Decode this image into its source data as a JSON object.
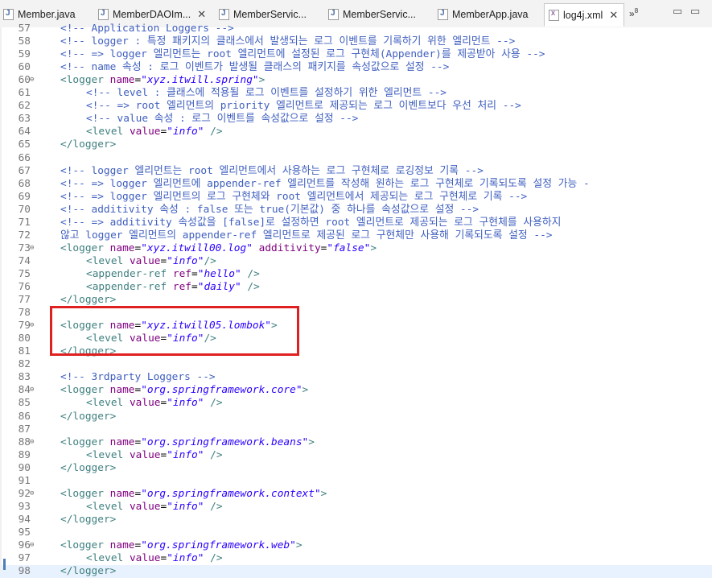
{
  "tabs": [
    {
      "label": "Member.java",
      "icon": "java-file-icon",
      "active": false
    },
    {
      "label": "MemberDAOIm...",
      "icon": "java-file-icon",
      "active": false
    },
    {
      "label": "MemberServic...",
      "icon": "java-file-icon",
      "active": false
    },
    {
      "label": "MemberServic...",
      "icon": "java-file-icon",
      "active": false
    },
    {
      "label": "MemberApp.java",
      "icon": "java-file-icon",
      "active": false
    },
    {
      "label": "log4j.xml",
      "icon": "xml-file-icon",
      "active": true
    }
  ],
  "overflow_count": "8",
  "highlight_color": "#e02020",
  "lines": [
    {
      "n": "57",
      "text": "<!-- Application Loggers -->"
    },
    {
      "n": "58",
      "text": "<!-- logger : 특정 패키지의 클래스에서 발생되는 로그 이벤트를 기록하기 위한 엘리먼트 -->"
    },
    {
      "n": "59",
      "text": "<!-- => logger 엘리먼트는 root 엘리먼트에 설정된 로그 구현체(Appender)를 제공받아 사용 -->"
    },
    {
      "n": "60",
      "text": "<!-- name 속성 : 로그 이벤트가 발생될 클래스의 패키지를 속성값으로 설정 -->"
    },
    {
      "n": "60",
      "text": "<logger name=\"xyz.itwill.spring\">"
    },
    {
      "n": "61",
      "text": "<!-- level : 클래스에 적용될 로그 이벤트를 설정하기 위한 엘리먼트 -->"
    },
    {
      "n": "62",
      "text": "<!-- => root 엘리먼트의 priority 엘리먼트로 제공되는 로그 이벤트보다 우선 처리 -->"
    },
    {
      "n": "63",
      "text": "<!-- value 속성 : 로그 이벤트를 속성값으로 설정 -->"
    },
    {
      "n": "64",
      "text": "<level value=\"info\" />"
    },
    {
      "n": "65",
      "text": "</logger>"
    },
    {
      "n": "66",
      "text": ""
    },
    {
      "n": "67",
      "text": "<!-- logger 엘리먼트는 root 엘리먼트에서 사용하는 로그 구현체로 로깅정보 기록 -->"
    },
    {
      "n": "68",
      "text": "<!-- => logger 엘리먼트에 appender-ref 엘리먼트를 작성해 원하는 로그 구현체로 기록되도록 설정 가능 -"
    },
    {
      "n": "69",
      "text": "<!-- => logger 엘리먼트의 로그 구현체와 root 엘리먼트에서 제공되는 로그 구현체로 기록 -->"
    },
    {
      "n": "70",
      "text": "<!-- additivity 속성 : false 또는 true(기본값) 중 하나를 속성값으로 설정 -->"
    },
    {
      "n": "71",
      "text": "<!-- => additivity 속성값을 [false]로 설정하면 root 엘리먼트로 제공되는 로그 구현체를 사용하지"
    },
    {
      "n": "72",
      "text": "않고 logger 엘리먼트의 appender-ref 엘리먼트로 제공된 로그 구현체만 사용해 기록되도록 설정 -->"
    },
    {
      "n": "73",
      "text": "<logger name=\"xyz.itwill00.log\" additivity=\"false\">"
    },
    {
      "n": "74",
      "text": "<level value=\"info\"/>"
    },
    {
      "n": "75",
      "text": "<appender-ref ref=\"hello\" />"
    },
    {
      "n": "76",
      "text": "<appender-ref ref=\"daily\" />"
    },
    {
      "n": "77",
      "text": "</logger>"
    },
    {
      "n": "78",
      "text": ""
    },
    {
      "n": "79",
      "text": "<logger name=\"xyz.itwill05.lombok\">"
    },
    {
      "n": "80",
      "text": "<level value=\"info\"/>"
    },
    {
      "n": "81",
      "text": "</logger>"
    },
    {
      "n": "82",
      "text": ""
    },
    {
      "n": "83",
      "text": "<!-- 3rdparty Loggers -->"
    },
    {
      "n": "84",
      "text": "<logger name=\"org.springframework.core\">"
    },
    {
      "n": "85",
      "text": "<level value=\"info\" />"
    },
    {
      "n": "86",
      "text": "</logger>"
    },
    {
      "n": "87",
      "text": ""
    },
    {
      "n": "88",
      "text": "<logger name=\"org.springframework.beans\">"
    },
    {
      "n": "89",
      "text": "<level value=\"info\" />"
    },
    {
      "n": "90",
      "text": "</logger>"
    },
    {
      "n": "91",
      "text": ""
    },
    {
      "n": "92",
      "text": "<logger name=\"org.springframework.context\">"
    },
    {
      "n": "93",
      "text": "<level value=\"info\" />"
    },
    {
      "n": "94",
      "text": "</logger>"
    },
    {
      "n": "95",
      "text": ""
    },
    {
      "n": "96",
      "text": "<logger name=\"org.springframework.web\">"
    },
    {
      "n": "97",
      "text": "<level value=\"info\" />"
    },
    {
      "n": "98",
      "text": "</logger>"
    }
  ]
}
